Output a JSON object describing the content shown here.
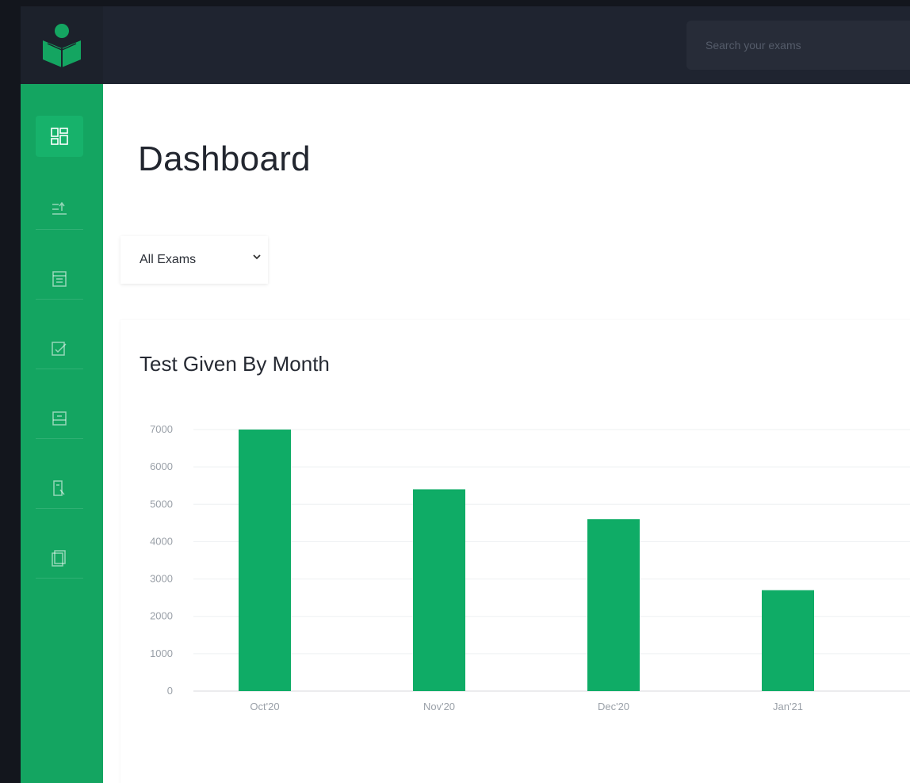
{
  "header": {
    "search_placeholder": "Search your exams"
  },
  "sidebar": {
    "items": [
      {
        "icon": "dashboard-icon",
        "active": true
      },
      {
        "icon": "exam-list-icon",
        "active": false
      },
      {
        "icon": "calendar-icon",
        "active": false
      },
      {
        "icon": "edit-exam-icon",
        "active": false
      },
      {
        "icon": "results-icon",
        "active": false
      },
      {
        "icon": "report-icon",
        "active": false
      },
      {
        "icon": "documents-icon",
        "active": false
      }
    ]
  },
  "main": {
    "title": "Dashboard",
    "filter": {
      "selected": "All Exams"
    }
  },
  "colors": {
    "accent": "#14a561",
    "bar": "#0fac66",
    "topbar": "#1f2430"
  },
  "chart_data": {
    "type": "bar",
    "title": "Test Given By Month",
    "categories": [
      "Oct'20",
      "Nov'20",
      "Dec'20",
      "Jan'21"
    ],
    "values": [
      7000,
      5400,
      4600,
      2700
    ],
    "yticks": [
      0,
      1000,
      2000,
      3000,
      4000,
      5000,
      6000,
      7000
    ],
    "ylim": [
      0,
      7000
    ],
    "xlabel": "",
    "ylabel": "",
    "grid": true
  }
}
